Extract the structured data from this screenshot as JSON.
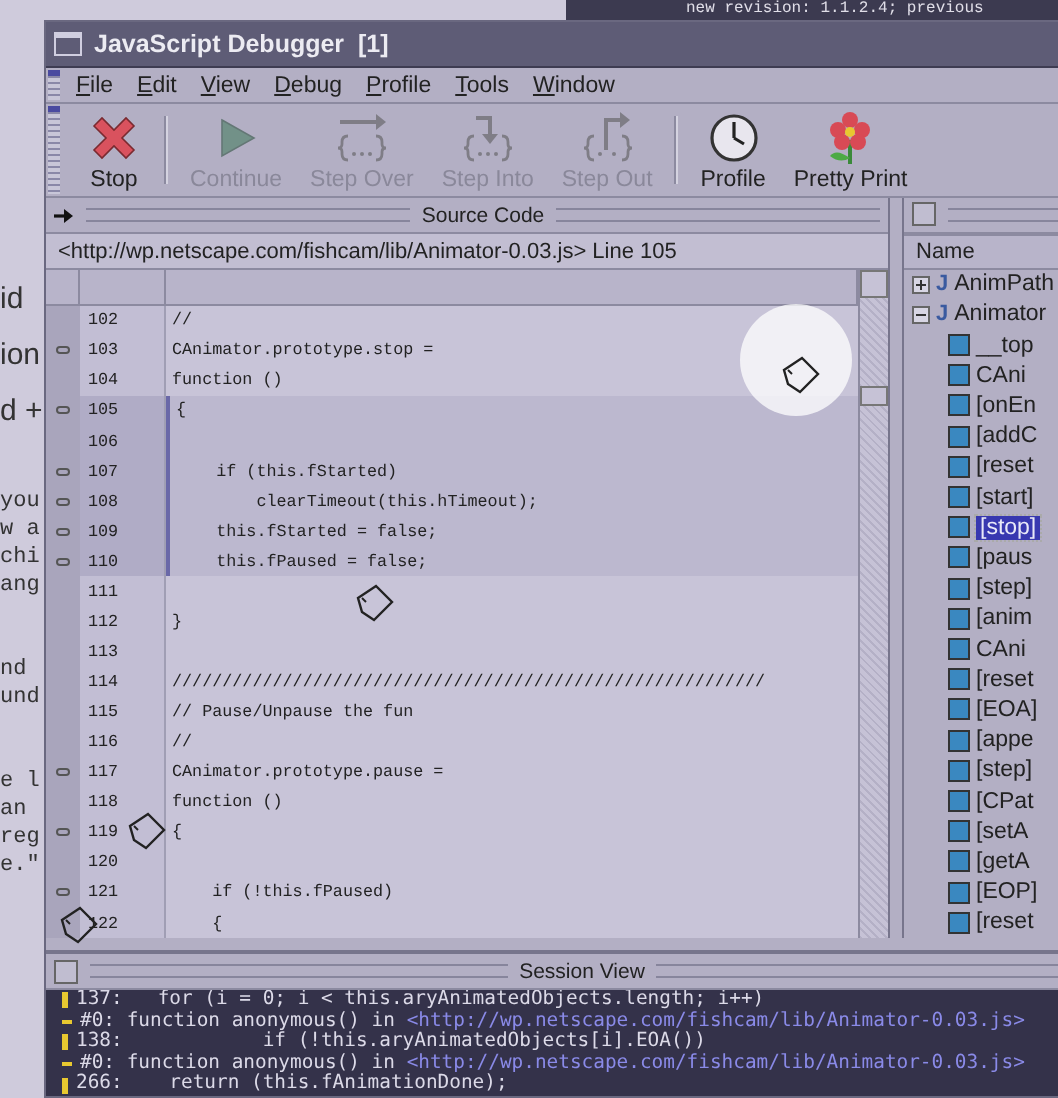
{
  "background_window": {
    "text": "new revision: 1.1.2.4; previous"
  },
  "background_text": [
    [
      "id",
      "ion",
      "d +"
    ],
    [
      "you",
      "w a",
      "chi",
      "ang"
    ],
    [
      "nd",
      "und"
    ],
    [
      "e l",
      "an",
      "reg",
      "e.\""
    ]
  ],
  "window": {
    "title": "JavaScript Debugger  [1]"
  },
  "menu": [
    "File",
    "Edit",
    "View",
    "Debug",
    "Profile",
    "Tools",
    "Window"
  ],
  "toolbar": [
    [
      {
        "label": "Stop",
        "kind": "stop",
        "disabled": false
      }
    ],
    [
      {
        "label": "Continue",
        "kind": "continue",
        "disabled": true
      },
      {
        "label": "Step Over",
        "kind": "step-over",
        "disabled": true
      },
      {
        "label": "Step Into",
        "kind": "step-into",
        "disabled": true
      },
      {
        "label": "Step Out",
        "kind": "step-out",
        "disabled": true
      }
    ],
    [
      {
        "label": "Profile",
        "kind": "profile",
        "disabled": false
      },
      {
        "label": "Pretty Print",
        "kind": "pretty-print",
        "disabled": false
      }
    ]
  ],
  "source_code": {
    "title": "Source Code",
    "location": "<http://wp.netscape.com/fishcam/lib/Animator-0.03.js> Line 105",
    "lines": [
      {
        "number": "102",
        "code": "//",
        "breakpoint_marker": false,
        "current": false
      },
      {
        "number": "103",
        "code": "CAnimator.prototype.stop =",
        "breakpoint_marker": true,
        "current": false
      },
      {
        "number": "104",
        "code": "function ()",
        "breakpoint_marker": false,
        "current": false
      },
      {
        "number": "105",
        "code": "{",
        "breakpoint_marker": true,
        "current": true
      },
      {
        "number": "106",
        "breakpoint_marker": false,
        "current": true
      },
      {
        "number": "107",
        "code": "    if (this.fStarted)",
        "breakpoint_marker": true,
        "current": true
      },
      {
        "number": "108",
        "code": "        clearTimeout(this.hTimeout);",
        "breakpoint_marker": true,
        "current": true
      },
      {
        "number": "109",
        "code": "    this.fStarted = false;",
        "breakpoint_marker": true,
        "current": true
      },
      {
        "number": "110",
        "code": "    this.fPaused = false;",
        "breakpoint_marker": true,
        "current": true
      },
      {
        "number": "111",
        "breakpoint_marker": false,
        "current": false
      },
      {
        "number": "112",
        "code": "}",
        "breakpoint_marker": false,
        "current": false
      },
      {
        "number": "113",
        "breakpoint_marker": false,
        "current": false
      },
      {
        "number": "114",
        "code": "///////////////////////////////////////////////////////////",
        "breakpoint_marker": false,
        "current": false
      },
      {
        "number": "115",
        "code": "// Pause/Unpause the fun",
        "breakpoint_marker": false,
        "current": false
      },
      {
        "number": "116",
        "code": "//",
        "breakpoint_marker": false,
        "current": false
      },
      {
        "number": "117",
        "code": "CAnimator.prototype.pause =",
        "breakpoint_marker": true,
        "current": false
      },
      {
        "number": "118",
        "code": "function ()",
        "breakpoint_marker": false,
        "current": false
      },
      {
        "number": "119",
        "code": "{",
        "breakpoint_marker": true,
        "current": false
      },
      {
        "number": "120",
        "breakpoint_marker": false,
        "current": false
      },
      {
        "number": "121",
        "code": "    if (!this.fPaused)",
        "breakpoint_marker": true,
        "current": false
      },
      {
        "number": "122",
        "code": "    {",
        "breakpoint_marker": false,
        "current": false
      }
    ]
  },
  "tree": {
    "column": "Name",
    "items": [
      {
        "label": "AnimPath",
        "badge": "J",
        "expanded": false,
        "selected": false
      },
      {
        "label": "Animator",
        "badge": "J",
        "expanded": true,
        "selected": false,
        "children": [
          {
            "label": "__top",
            "selected": false
          },
          {
            "label": "CAni",
            "selected": false
          },
          {
            "label": "[onEn",
            "selected": false
          },
          {
            "label": "[addC",
            "selected": false
          },
          {
            "label": "[reset",
            "selected": false
          },
          {
            "label": "[start]",
            "selected": false
          },
          {
            "label": "[stop]",
            "selected": true
          },
          {
            "label": "[paus",
            "selected": false
          },
          {
            "label": "[step]",
            "selected": false
          },
          {
            "label": "[anim",
            "selected": false
          },
          {
            "label": "CAni",
            "selected": false
          },
          {
            "label": "[reset",
            "selected": false
          },
          {
            "label": "[EOA]",
            "selected": false
          },
          {
            "label": "[appe",
            "selected": false
          },
          {
            "label": "[step]",
            "selected": false
          },
          {
            "label": "[CPat",
            "selected": false
          },
          {
            "label": "[setA",
            "selected": false
          },
          {
            "label": "[getA",
            "selected": false
          },
          {
            "label": "[EOP]",
            "selected": false
          },
          {
            "label": "[reset",
            "selected": false
          }
        ]
      }
    ]
  },
  "session_view": {
    "title": "Session View",
    "lines": [
      {
        "kind": "source",
        "text": "137:   for (i = 0; i < this.aryAnimatedObjects.length; i++)"
      },
      {
        "kind": "frame",
        "text": "#0: function anonymous() in ",
        "link": "<http://wp.netscape.com/fishcam/lib/Animator-0.03.js>"
      },
      {
        "kind": "source",
        "text": "138:            if (!this.aryAnimatedObjects[i].EOA())"
      },
      {
        "kind": "frame",
        "text": "#0: function anonymous() in ",
        "link": "<http://wp.netscape.com/fishcam/lib/Animator-0.03.js>"
      },
      {
        "kind": "source",
        "text": "266:    return (this.fAnimationDone);"
      }
    ]
  }
}
